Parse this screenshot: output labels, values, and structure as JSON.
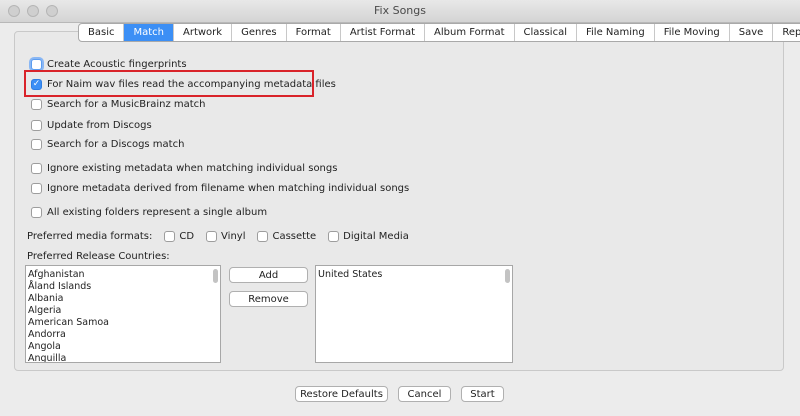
{
  "window": {
    "title": "Fix Songs"
  },
  "tabs": [
    {
      "label": "Basic",
      "active": false
    },
    {
      "label": "Match",
      "active": true
    },
    {
      "label": "Artwork",
      "active": false
    },
    {
      "label": "Genres",
      "active": false
    },
    {
      "label": "Format",
      "active": false
    },
    {
      "label": "Artist Format",
      "active": false
    },
    {
      "label": "Album Format",
      "active": false
    },
    {
      "label": "Classical",
      "active": false
    },
    {
      "label": "File Naming",
      "active": false
    },
    {
      "label": "File Moving",
      "active": false
    },
    {
      "label": "Save",
      "active": false
    },
    {
      "label": "Reports",
      "active": false
    }
  ],
  "options": {
    "acoustic": {
      "label": "Create Acoustic fingerprints",
      "checked": false
    },
    "naim": {
      "label": "For Naim wav files read the accompanying metadata files",
      "checked": true
    },
    "musicbrainz": {
      "label": "Search for a MusicBrainz match",
      "checked": false
    },
    "update_discogs": {
      "label": "Update from Discogs",
      "checked": false
    },
    "search_discogs": {
      "label": "Search for a Discogs match",
      "checked": false
    },
    "ignore_existing": {
      "label": "Ignore existing metadata when matching individual songs",
      "checked": false
    },
    "ignore_filename": {
      "label": "Ignore metadata derived from filename when matching individual songs",
      "checked": false
    },
    "single_album": {
      "label": "All existing folders represent a single album",
      "checked": false
    }
  },
  "media_formats": {
    "label": "Preferred media formats:",
    "items": [
      {
        "label": "CD",
        "checked": false
      },
      {
        "label": "Vinyl",
        "checked": false
      },
      {
        "label": "Cassette",
        "checked": false
      },
      {
        "label": "Digital Media",
        "checked": false
      }
    ]
  },
  "countries": {
    "label": "Preferred Release Countries:",
    "available": [
      "Afghanistan",
      "Åland Islands",
      "Albania",
      "Algeria",
      "American Samoa",
      "Andorra",
      "Angola",
      "Anguilla"
    ],
    "selected": [
      "United States"
    ],
    "add_label": "Add",
    "remove_label": "Remove"
  },
  "footer": {
    "restore_label": "Restore Defaults",
    "cancel_label": "Cancel",
    "start_label": "Start"
  }
}
